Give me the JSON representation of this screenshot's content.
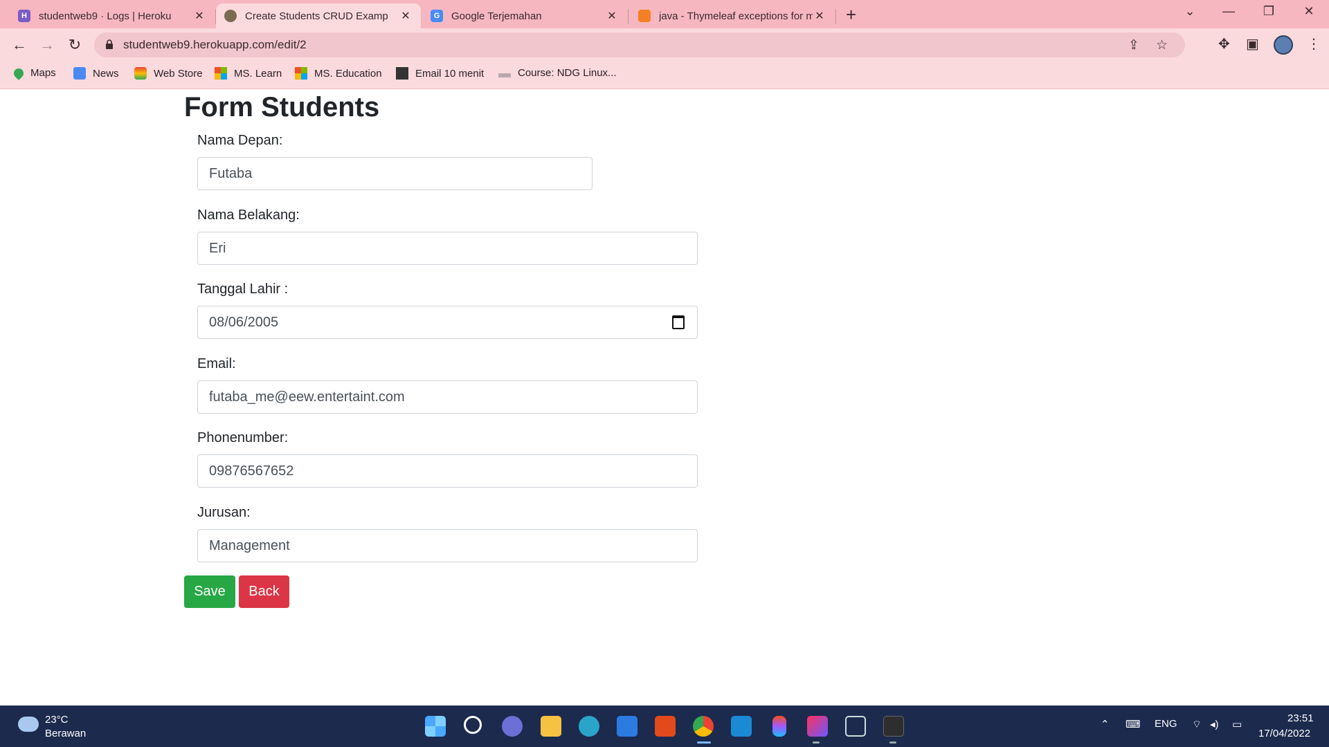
{
  "browser": {
    "tabs": [
      {
        "title": "studentweb9 · Logs | Heroku",
        "icon": "heroku-icon",
        "active": false
      },
      {
        "title": "Create Students CRUD Examp",
        "icon": "site-icon",
        "active": true
      },
      {
        "title": "Google Terjemahan",
        "icon": "google-translate-icon",
        "active": false
      },
      {
        "title": "java - Thymeleaf exceptions for m",
        "icon": "stackoverflow-icon",
        "active": false
      }
    ],
    "url": "studentweb9.herokuapp.com/edit/2",
    "bookmarks": [
      {
        "label": "Maps",
        "icon": "maps-icon"
      },
      {
        "label": "News",
        "icon": "news-icon"
      },
      {
        "label": "Web Store",
        "icon": "webstore-icon"
      },
      {
        "label": "MS. Learn",
        "icon": "microsoft-icon"
      },
      {
        "label": "MS. Education",
        "icon": "microsoft-icon"
      },
      {
        "label": "Email 10 menit",
        "icon": "email10-icon"
      },
      {
        "label": "Course: NDG Linux...",
        "icon": "cisco-icon"
      }
    ]
  },
  "form": {
    "title": "Form Students",
    "fields": {
      "first_name": {
        "label": "Nama Depan:",
        "value": "Futaba"
      },
      "last_name": {
        "label": "Nama Belakang:",
        "value": "Eri"
      },
      "birth_date": {
        "label": "Tanggal Lahir :",
        "value": "08/06/2005"
      },
      "email": {
        "label": "Email:",
        "value": "futaba_me@eew.entertaint.com"
      },
      "phone": {
        "label": "Phonenumber:",
        "value": "09876567652"
      },
      "major": {
        "label": "Jurusan:",
        "value": "Management"
      }
    },
    "save_label": "Save",
    "back_label": "Back",
    "colors": {
      "save": "#28a745",
      "back": "#dc3545"
    }
  },
  "taskbar": {
    "weather_temp": "23°C",
    "weather_desc": "Berawan",
    "lang": "ENG",
    "time": "23:51",
    "date": "17/04/2022"
  }
}
